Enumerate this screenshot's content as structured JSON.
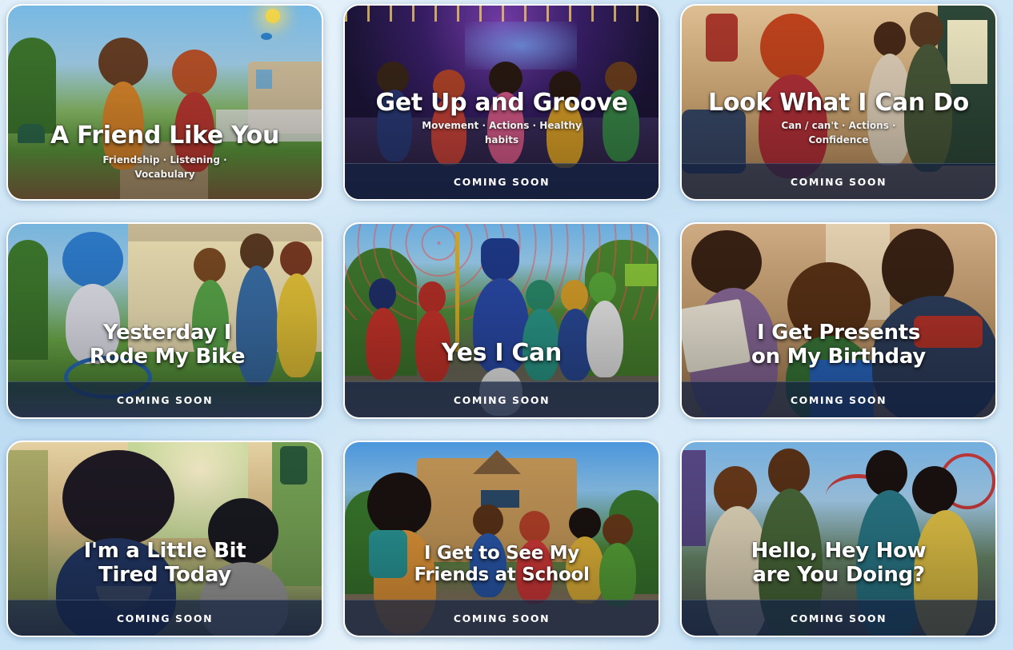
{
  "cards": [
    {
      "title_lines": [
        "A Friend Like You"
      ],
      "tags": "Friendship · Listening · Vocabulary",
      "status": "",
      "scene": "two-kids-neighborhood-icon"
    },
    {
      "title_lines": [
        "Get Up and Groove"
      ],
      "tags": "Movement · Actions · Healthy habits",
      "status": "COMING SOON",
      "scene": "kids-dancing-stage-icon"
    },
    {
      "title_lines": [
        "Look What I Can Do"
      ],
      "tags": "Can / can't · Actions · Confidence",
      "status": "COMING SOON",
      "scene": "girl-with-parents-home-icon"
    },
    {
      "title_lines": [
        "Yesterday I",
        "Rode My Bike"
      ],
      "tags": "",
      "status": "COMING SOON",
      "scene": "boy-on-bike-family-icon"
    },
    {
      "title_lines": [
        "Yes I Can"
      ],
      "tags": "",
      "status": "COMING SOON",
      "scene": "marching-band-parade-icon"
    },
    {
      "title_lines": [
        "I Get Presents",
        "on My Birthday"
      ],
      "tags": "",
      "status": "COMING SOON",
      "scene": "birthday-presents-family-icon"
    },
    {
      "title_lines": [
        "I'm a Little Bit",
        "Tired Today"
      ],
      "tags": "",
      "status": "COMING SOON",
      "scene": "sleepy-kids-breakfast-icon"
    },
    {
      "title_lines": [
        "I Get to See My",
        "Friends at School"
      ],
      "tags": "",
      "status": "COMING SOON",
      "scene": "kids-arriving-school-icon"
    },
    {
      "title_lines": [
        "Hello, Hey How",
        "are You Doing?"
      ],
      "tags": "",
      "status": "COMING SOON",
      "scene": "adults-greeting-fair-icon"
    }
  ],
  "colors": {
    "status_bar": "#142242",
    "card_border": "#ffffff",
    "page_bg": "#c4e0f4"
  }
}
